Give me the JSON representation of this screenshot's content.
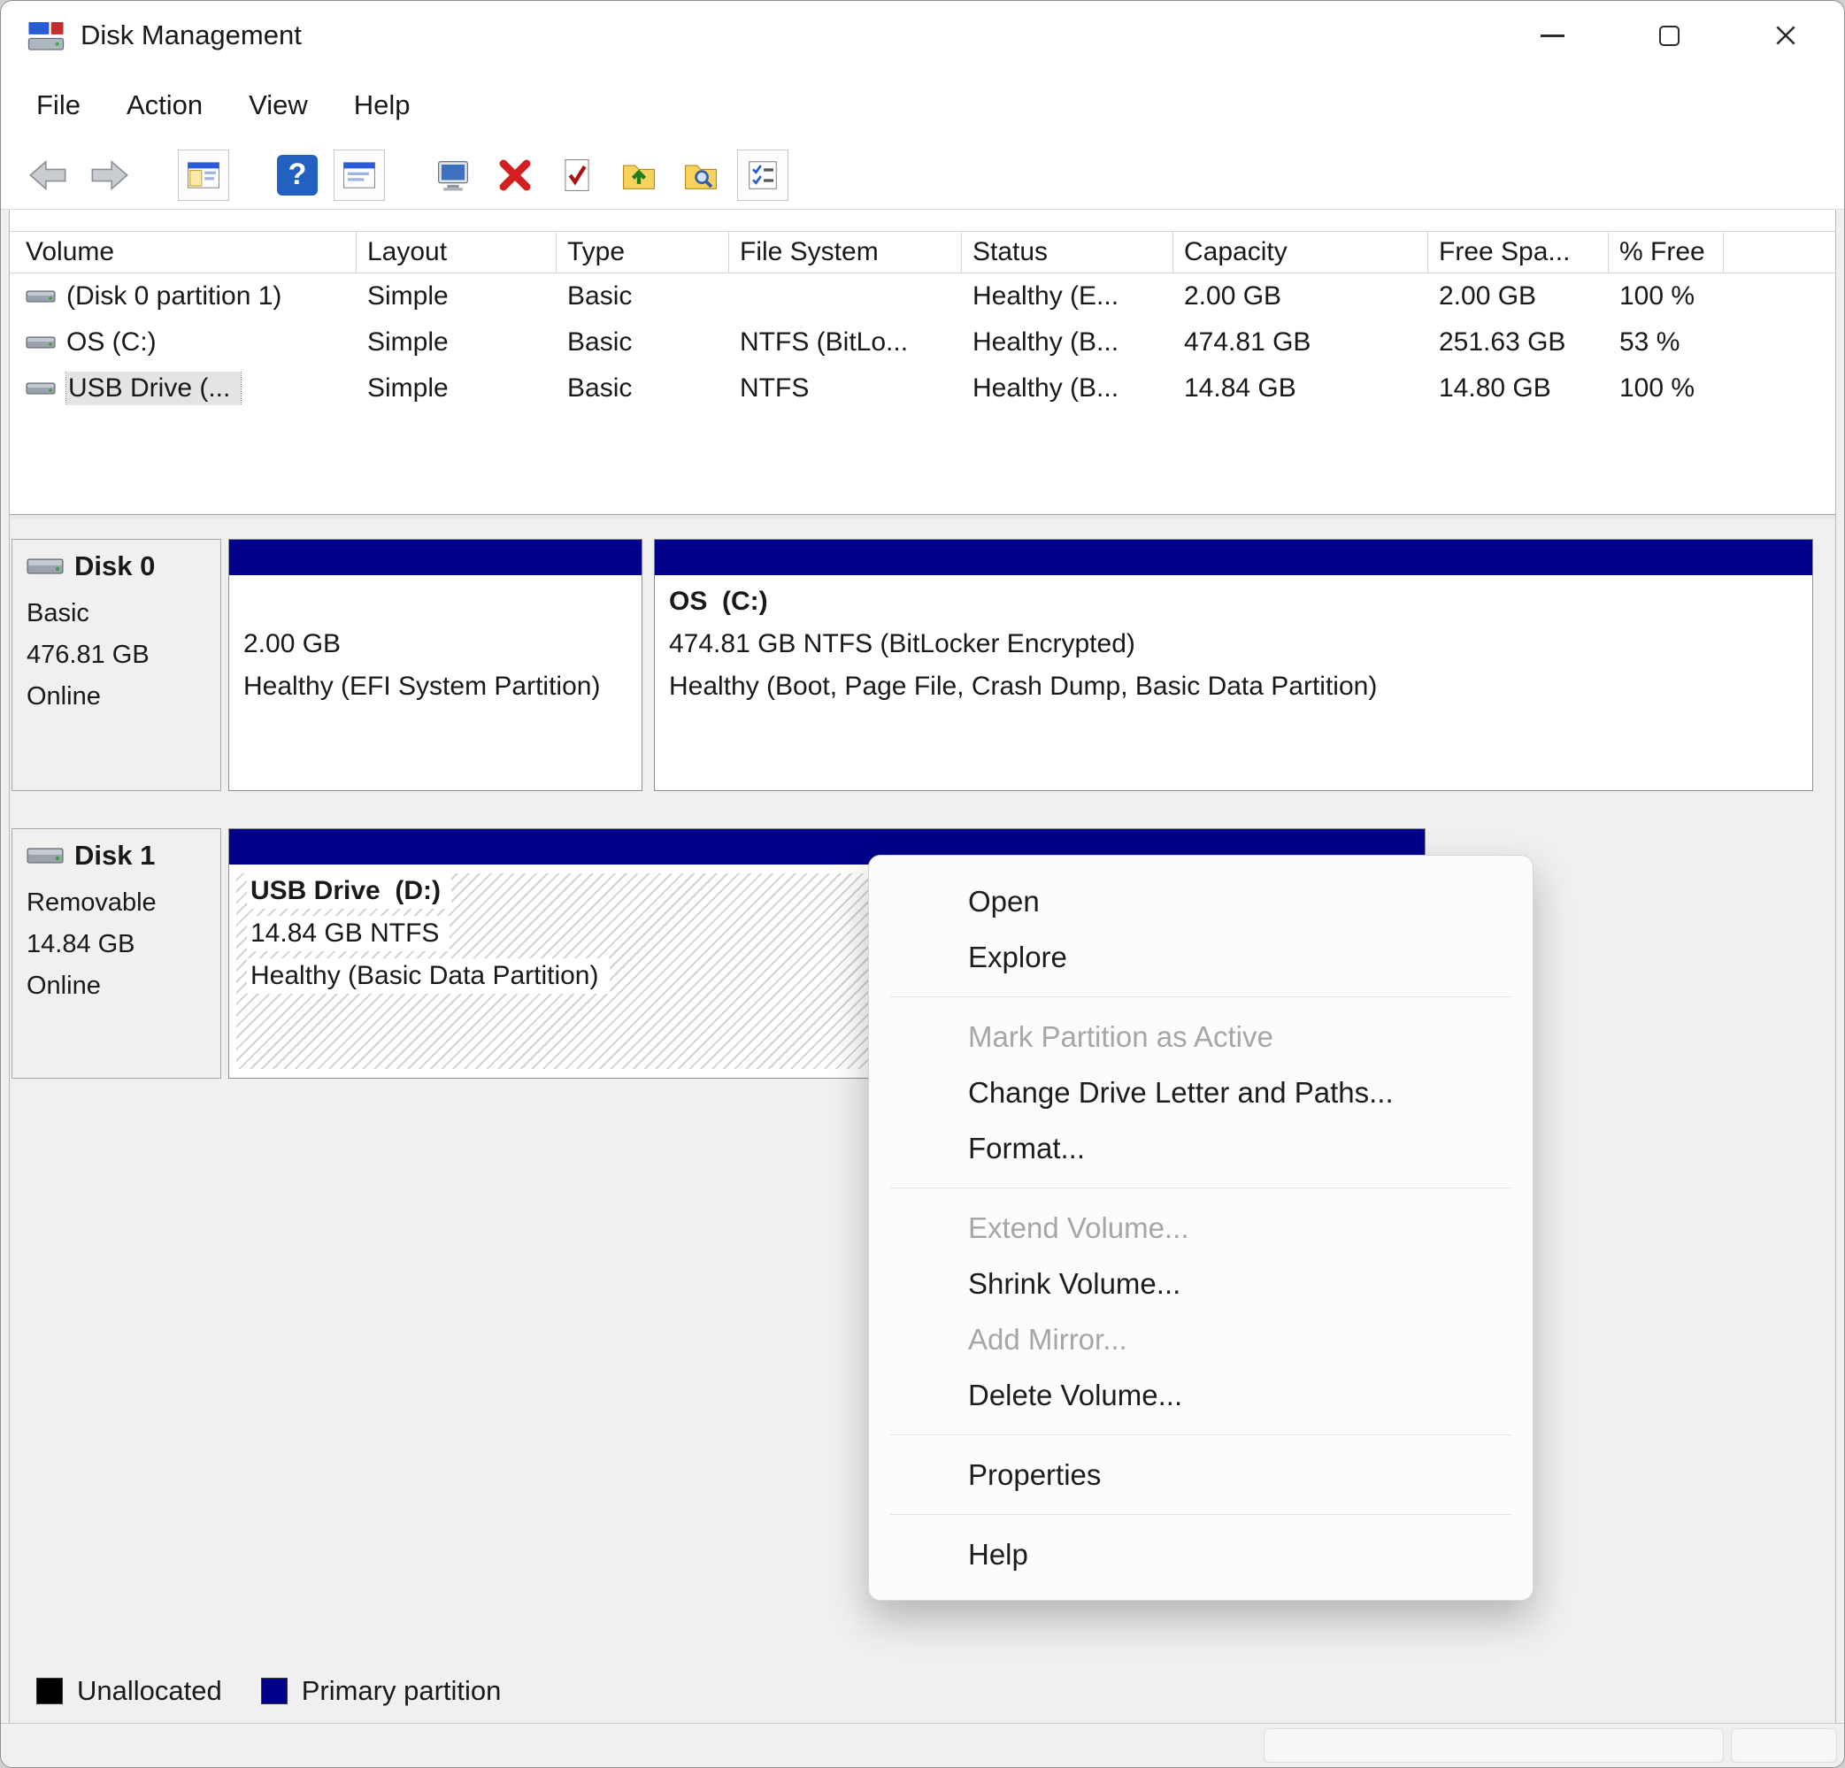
{
  "window": {
    "title": "Disk Management",
    "controls": [
      "minimize",
      "maximize",
      "close"
    ]
  },
  "menu_bar": {
    "items": [
      "File",
      "Action",
      "View",
      "Help"
    ]
  },
  "toolbar": {
    "icons": [
      "back-arrow",
      "forward-arrow",
      "console-tree-window",
      "help",
      "properties-window",
      "computer",
      "delete-cross",
      "check-document",
      "folder-up",
      "folder-search",
      "list-checks"
    ],
    "help_glyph": "?"
  },
  "volume_table": {
    "columns": [
      "Volume",
      "Layout",
      "Type",
      "File System",
      "Status",
      "Capacity",
      "Free Spa...",
      "% Free"
    ],
    "rows": [
      {
        "volume": "(Disk 0 partition 1)",
        "layout": "Simple",
        "type": "Basic",
        "file_system": "",
        "status": "Healthy (E...",
        "capacity": "2.00 GB",
        "free_space": "2.00 GB",
        "pct_free": "100 %"
      },
      {
        "volume": "OS (C:)",
        "layout": "Simple",
        "type": "Basic",
        "file_system": "NTFS (BitLo...",
        "status": "Healthy (B...",
        "capacity": "474.81 GB",
        "free_space": "251.63 GB",
        "pct_free": "53 %"
      },
      {
        "volume": "USB Drive (...",
        "layout": "Simple",
        "type": "Basic",
        "file_system": "NTFS",
        "status": "Healthy (B...",
        "capacity": "14.84 GB",
        "free_space": "14.80 GB",
        "pct_free": "100 %"
      }
    ]
  },
  "disks": [
    {
      "name": "Disk 0",
      "kind": "Basic",
      "size": "476.81 GB",
      "status": "Online",
      "partitions": [
        {
          "title": "",
          "line1": "2.00 GB",
          "line2": "Healthy (EFI System Partition)"
        },
        {
          "title": "OS  (C:)",
          "line1": "474.81 GB NTFS (BitLocker Encrypted)",
          "line2": "Healthy (Boot, Page File, Crash Dump, Basic Data Partition)"
        }
      ]
    },
    {
      "name": "Disk 1",
      "kind": "Removable",
      "size": "14.84 GB",
      "status": "Online",
      "partitions": [
        {
          "title": "USB Drive  (D:)",
          "line1": "14.84 GB NTFS",
          "line2": "Healthy (Basic Data Partition)"
        }
      ]
    }
  ],
  "context_menu": {
    "items": [
      {
        "label": "Open",
        "enabled": true
      },
      {
        "label": "Explore",
        "enabled": true
      },
      {
        "label": "Mark Partition as Active",
        "enabled": false
      },
      {
        "label": "Change Drive Letter and Paths...",
        "enabled": true
      },
      {
        "label": "Format...",
        "enabled": true
      },
      {
        "label": "Extend Volume...",
        "enabled": false
      },
      {
        "label": "Shrink Volume...",
        "enabled": true
      },
      {
        "label": "Add Mirror...",
        "enabled": false
      },
      {
        "label": "Delete Volume...",
        "enabled": true
      },
      {
        "label": "Properties",
        "enabled": true
      },
      {
        "label": "Help",
        "enabled": true
      }
    ]
  },
  "legend": {
    "items": [
      {
        "label": "Unallocated",
        "color": "#000000"
      },
      {
        "label": "Primary partition",
        "color": "#00008b"
      }
    ]
  },
  "colors": {
    "partition_strip": "#00008b",
    "window_bg": "#f0f0f0",
    "accent_help": "#2361c0"
  }
}
